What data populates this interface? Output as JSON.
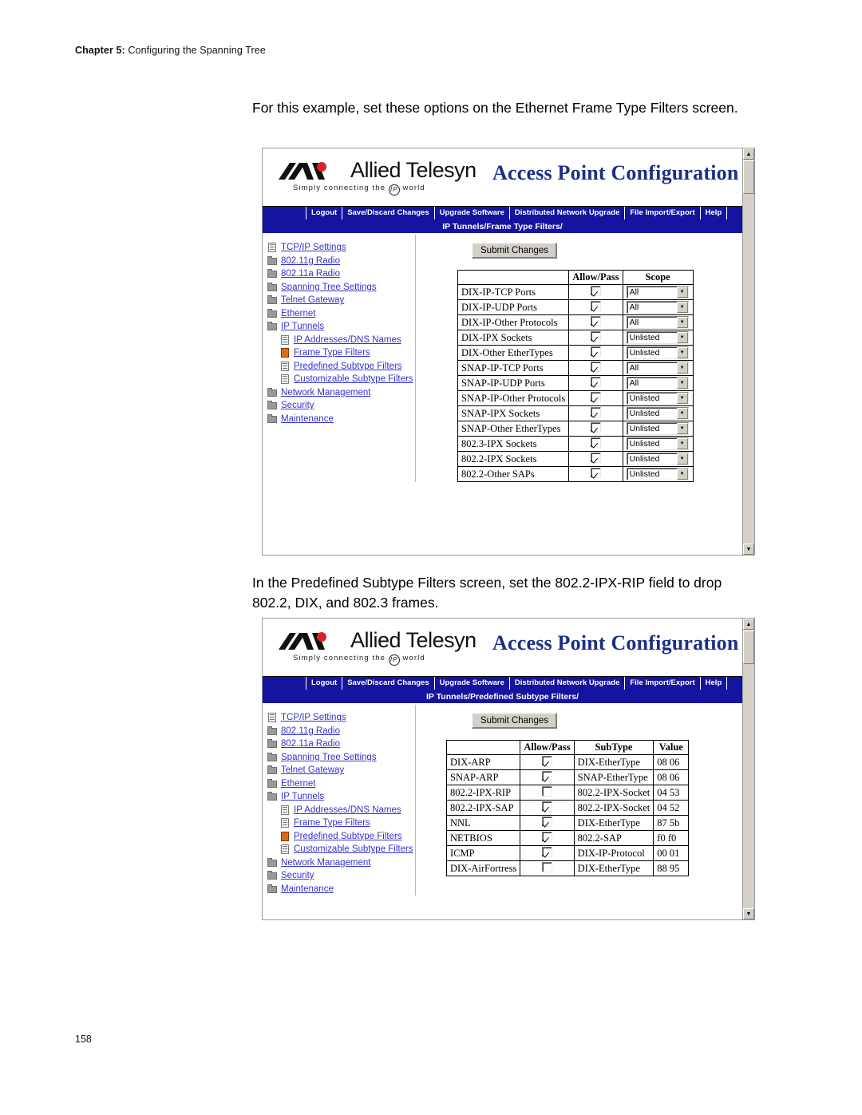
{
  "page": {
    "header_chapter": "Chapter 5:",
    "header_title": "Configuring the Spanning Tree",
    "number": "158"
  },
  "paragraphs": {
    "p1": "For this example, set these options on the Ethernet Frame Type Filters screen.",
    "p2": "In the Predefined Subtype Filters screen, set the 802.2-IPX-RIP field to drop 802.2, DIX, and 802.3 frames."
  },
  "app": {
    "brand": "Allied Telesyn",
    "tagline": "Simply  connecting  the",
    "tagline_ip": "IP",
    "tagline_end": "world",
    "title": "Access Point Configuration",
    "nav": [
      "Logout",
      "Save/Discard Changes",
      "Upgrade Software",
      "Distributed Network Upgrade",
      "File Import/Export",
      "Help"
    ],
    "sidebar": [
      {
        "label": "TCP/IP Settings",
        "icon": "page-icon",
        "indent": false,
        "selected": false
      },
      {
        "label": "802.11g Radio",
        "icon": "folder-icon",
        "indent": false,
        "selected": false
      },
      {
        "label": "802.11a Radio",
        "icon": "folder-icon",
        "indent": false,
        "selected": false
      },
      {
        "label": "Spanning Tree Settings",
        "icon": "folder-icon",
        "indent": false,
        "selected": false
      },
      {
        "label": "Telnet Gateway",
        "icon": "folder-icon",
        "indent": false,
        "selected": false
      },
      {
        "label": "Ethernet",
        "icon": "folder-icon",
        "indent": false,
        "selected": false
      },
      {
        "label": "IP Tunnels",
        "icon": "folder-icon",
        "indent": false,
        "selected": false
      },
      {
        "label": "IP Addresses/DNS Names",
        "icon": "page-icon",
        "indent": true,
        "selected": false
      },
      {
        "label": "Frame Type Filters",
        "icon": "page-icon",
        "indent": true,
        "selected": false
      },
      {
        "label": "Predefined Subtype Filters",
        "icon": "page-icon",
        "indent": true,
        "selected": false
      },
      {
        "label": "Customizable Subtype Filters",
        "icon": "page-icon",
        "indent": true,
        "selected": false
      },
      {
        "label": "Network Management",
        "icon": "folder-icon",
        "indent": false,
        "selected": false
      },
      {
        "label": "Security",
        "icon": "folder-icon",
        "indent": false,
        "selected": false
      },
      {
        "label": "Maintenance",
        "icon": "folder-icon",
        "indent": false,
        "selected": false
      }
    ],
    "submit_label": "Submit Changes"
  },
  "screen1": {
    "path": "IP Tunnels/Frame Type Filters/",
    "selected_sidebar_index": 8,
    "table": {
      "headers": [
        "",
        "Allow/Pass",
        "Scope"
      ],
      "rows": [
        {
          "name": "DIX-IP-TCP Ports",
          "allow": true,
          "scope": "All"
        },
        {
          "name": "DIX-IP-UDP Ports",
          "allow": true,
          "scope": "All"
        },
        {
          "name": "DIX-IP-Other Protocols",
          "allow": true,
          "scope": "All"
        },
        {
          "name": "DIX-IPX Sockets",
          "allow": true,
          "scope": "Unlisted"
        },
        {
          "name": "DIX-Other EtherTypes",
          "allow": true,
          "scope": "Unlisted"
        },
        {
          "name": "SNAP-IP-TCP Ports",
          "allow": true,
          "scope": "All"
        },
        {
          "name": "SNAP-IP-UDP Ports",
          "allow": true,
          "scope": "All"
        },
        {
          "name": "SNAP-IP-Other Protocols",
          "allow": true,
          "scope": "Unlisted"
        },
        {
          "name": "SNAP-IPX Sockets",
          "allow": true,
          "scope": "Unlisted"
        },
        {
          "name": "SNAP-Other EtherTypes",
          "allow": true,
          "scope": "Unlisted"
        },
        {
          "name": "802.3-IPX Sockets",
          "allow": true,
          "scope": "Unlisted"
        },
        {
          "name": "802.2-IPX Sockets",
          "allow": true,
          "scope": "Unlisted"
        },
        {
          "name": "802.2-Other SAPs",
          "allow": true,
          "scope": "Unlisted"
        }
      ]
    }
  },
  "screen2": {
    "path": "IP Tunnels/Predefined Subtype Filters/",
    "selected_sidebar_index": 9,
    "table": {
      "headers": [
        "",
        "Allow/Pass",
        "SubType",
        "Value"
      ],
      "rows": [
        {
          "name": "DIX-ARP",
          "allow": true,
          "subtype": "DIX-EtherType",
          "value": "08 06"
        },
        {
          "name": "SNAP-ARP",
          "allow": true,
          "subtype": "SNAP-EtherType",
          "value": "08 06"
        },
        {
          "name": "802.2-IPX-RIP",
          "allow": false,
          "subtype": "802.2-IPX-Socket",
          "value": "04 53"
        },
        {
          "name": "802.2-IPX-SAP",
          "allow": true,
          "subtype": "802.2-IPX-Socket",
          "value": "04 52"
        },
        {
          "name": "NNL",
          "allow": true,
          "subtype": "DIX-EtherType",
          "value": "87 5b"
        },
        {
          "name": "NETBIOS",
          "allow": true,
          "subtype": "802.2-SAP",
          "value": "f0 f0"
        },
        {
          "name": "ICMP",
          "allow": true,
          "subtype": "DIX-IP-Protocol",
          "value": "00 01"
        },
        {
          "name": "DIX-AirFortress",
          "allow": false,
          "subtype": "DIX-EtherType",
          "value": "88 95"
        }
      ]
    }
  },
  "colors": {
    "nav_blue": "#1414a0",
    "title_blue": "#1b2f86",
    "link_blue": "#3333cc",
    "selected_orange": "#e06a10"
  }
}
